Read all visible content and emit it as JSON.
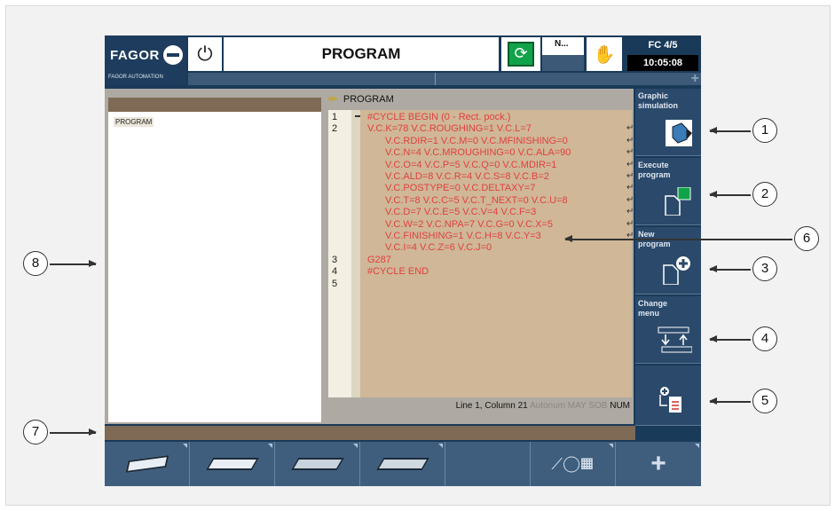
{
  "header": {
    "brand": "FAGOR",
    "brand_sub": "FAGOR AUTOMATION",
    "title": "PROGRAM",
    "channel_indicator": "N...",
    "fc_label": "FC 4/5",
    "time": "10:05:08"
  },
  "left_panel": {
    "label": "PROGRAM"
  },
  "program": {
    "title": "PROGRAM",
    "lines": [
      {
        "num": "1",
        "text": "#CYCLE BEGIN (0 - Rect. pock.)",
        "indent": 0,
        "wrap": false
      },
      {
        "num": "2",
        "text": "V.C.K=78 V.C.ROUGHING=1 V.C.L=7",
        "indent": 0,
        "wrap": true
      },
      {
        "num": "",
        "text": "V.C.RDIR=1 V.C.M=0 V.C.MFINISHING=0",
        "indent": 1,
        "wrap": true
      },
      {
        "num": "",
        "text": "V.C.N=4 V.C.MROUGHING=0 V.C.ALA=90",
        "indent": 1,
        "wrap": true
      },
      {
        "num": "",
        "text": "V.C.O=4 V.C.P=5 V.C.Q=0 V.C.MDIR=1",
        "indent": 1,
        "wrap": true
      },
      {
        "num": "",
        "text": "V.C.ALD=8 V.C.R=4 V.C.S=8 V.C.B=2",
        "indent": 1,
        "wrap": true
      },
      {
        "num": "",
        "text": "V.C.POSTYPE=0 V.C.DELTAXY=7",
        "indent": 1,
        "wrap": true
      },
      {
        "num": "",
        "text": "V.C.T=8 V.C.C=5 V.C.T_NEXT=0 V.C.U=8",
        "indent": 1,
        "wrap": true
      },
      {
        "num": "",
        "text": "V.C.D=7 V.C.E=5 V.C.V=4 V.C.F=3",
        "indent": 1,
        "wrap": true
      },
      {
        "num": "",
        "text": "V.C.W=2 V.C.NPA=7 V.C.G=0 V.C.X=5",
        "indent": 1,
        "wrap": true
      },
      {
        "num": "",
        "text": "V.C.FINISHING=1 V.C.H=8 V.C.Y=3",
        "indent": 1,
        "wrap": true
      },
      {
        "num": "",
        "text": "V.C.I=4 V.C.Z=6 V.C.J=0",
        "indent": 1,
        "wrap": false
      },
      {
        "num": "3",
        "text": "G287",
        "indent": 0,
        "wrap": false
      },
      {
        "num": "4",
        "text": "#CYCLE END",
        "indent": 0,
        "wrap": false
      },
      {
        "num": "5",
        "text": "",
        "indent": 0,
        "wrap": false
      }
    ],
    "status": {
      "position": "Line 1, Column 21",
      "autonum": "Autonum",
      "may": "MAY",
      "sob": "SOB",
      "num": "NUM"
    }
  },
  "softkeys": [
    {
      "label_1": "Graphic",
      "label_2": "simulation",
      "icon": "cube-icon"
    },
    {
      "label_1": "Execute",
      "label_2": "program",
      "icon": "execute-program-icon"
    },
    {
      "label_1": "New",
      "label_2": "program",
      "icon": "new-program-icon"
    },
    {
      "label_1": "Change",
      "label_2": "menu",
      "icon": "change-menu-icon"
    },
    {
      "label_1": "",
      "label_2": "",
      "icon": "insert-cycle-icon"
    }
  ],
  "bottom_keys": [
    "cycle-1-icon",
    "cycle-2-icon",
    "cycle-3-icon",
    "cycle-4-icon",
    "empty",
    "geometry-icon",
    "add-icon"
  ],
  "callouts": [
    "1",
    "2",
    "3",
    "4",
    "5",
    "6",
    "7",
    "8"
  ],
  "colors": {
    "screen_bg": "#1a3a59",
    "code_text": "#e04040",
    "code_bg": "#cfb797",
    "softkey_bg": "#2b4a6b",
    "exec_green": "#11a34a"
  }
}
